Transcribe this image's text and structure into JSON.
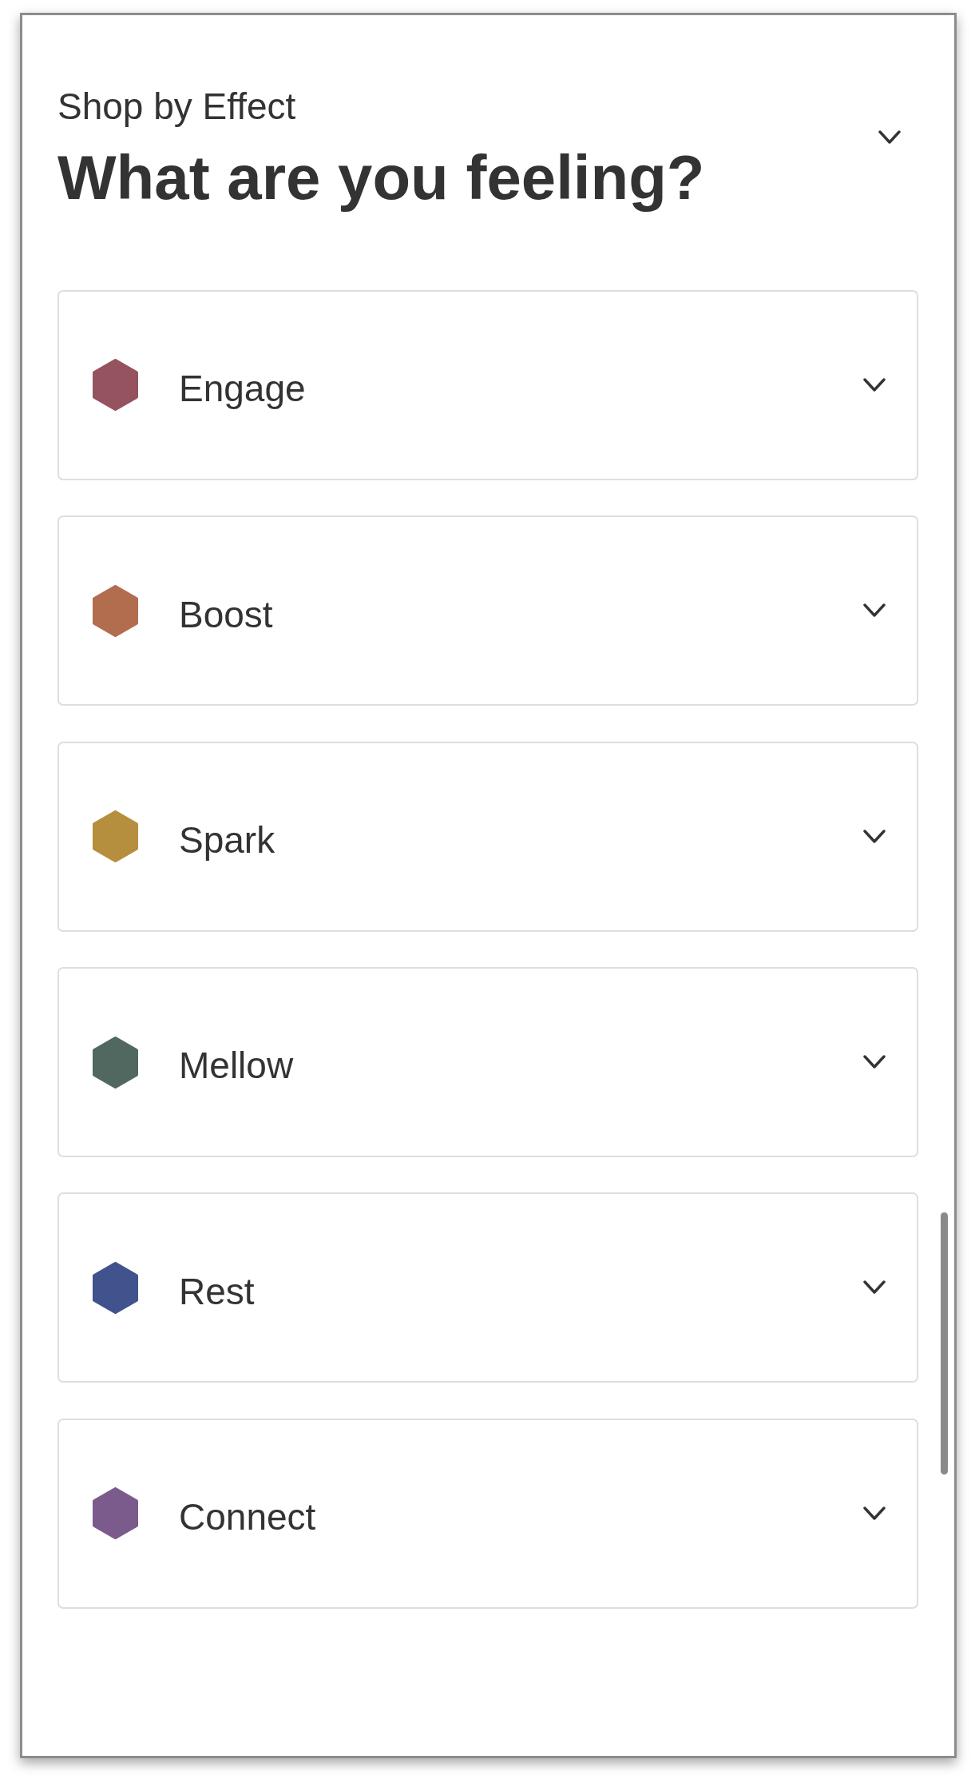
{
  "section": {
    "eyebrow": "Shop by Effect",
    "title": "What are you feeling?"
  },
  "effects": [
    {
      "label": "Engage",
      "color": "#94535f",
      "expanded": false
    },
    {
      "label": "Boost",
      "color": "#b26d4f",
      "expanded": false
    },
    {
      "label": "Spark",
      "color": "#b58f3d",
      "expanded": false
    },
    {
      "label": "Mellow",
      "color": "#506860",
      "expanded": false
    },
    {
      "label": "Rest",
      "color": "#40538d",
      "expanded": false
    },
    {
      "label": "Connect",
      "color": "#7b5b8c",
      "expanded": false
    }
  ]
}
